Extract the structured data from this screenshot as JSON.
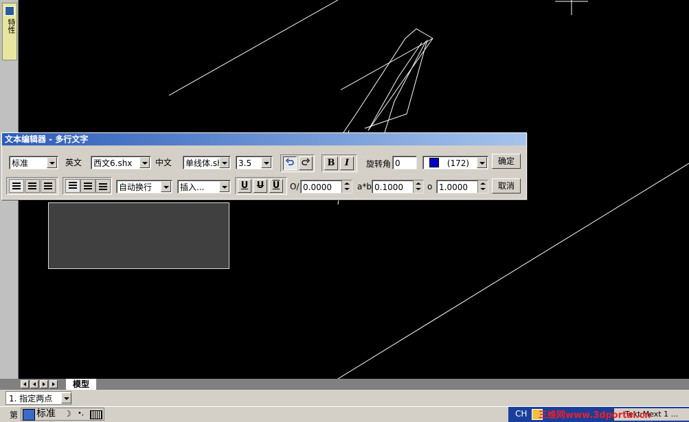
{
  "side_dock": {
    "label": "特性"
  },
  "editor": {
    "title": "文本编辑器 - 多行文字",
    "style_value": "标准",
    "english_label": "英文",
    "english_font": "西文6.shx",
    "chinese_label": "中文",
    "chinese_font": "单线体.sh",
    "height_value": "3.5",
    "bold_label": "B",
    "italic_label": "I",
    "rotation_label": "旋转角",
    "rotation_value": "0",
    "color_value": "(172)",
    "color_hex": "#0000c8",
    "ok_label": "确定",
    "wrap_value": "自动换行",
    "insert_value": "插入...",
    "u_label": "U",
    "strike_label": "U",
    "over_label": "U",
    "oblique_label": "O/",
    "oblique_value": "0.0000",
    "spacing_label": "a*b",
    "spacing_value": "0.1000",
    "width_label": "o",
    "width_value": "1.0000",
    "cancel_label": "取消"
  },
  "layout_tabs": {
    "model": "模型"
  },
  "command_line": {
    "prompt": "1. 指定两点"
  },
  "status_left": {
    "prefix": "第",
    "ime_mode": "标准"
  },
  "taskbar": {
    "lang": "CH",
    "watermark": "三维网www.3dportal.cn",
    "task": "Text Mext 1 ..."
  }
}
